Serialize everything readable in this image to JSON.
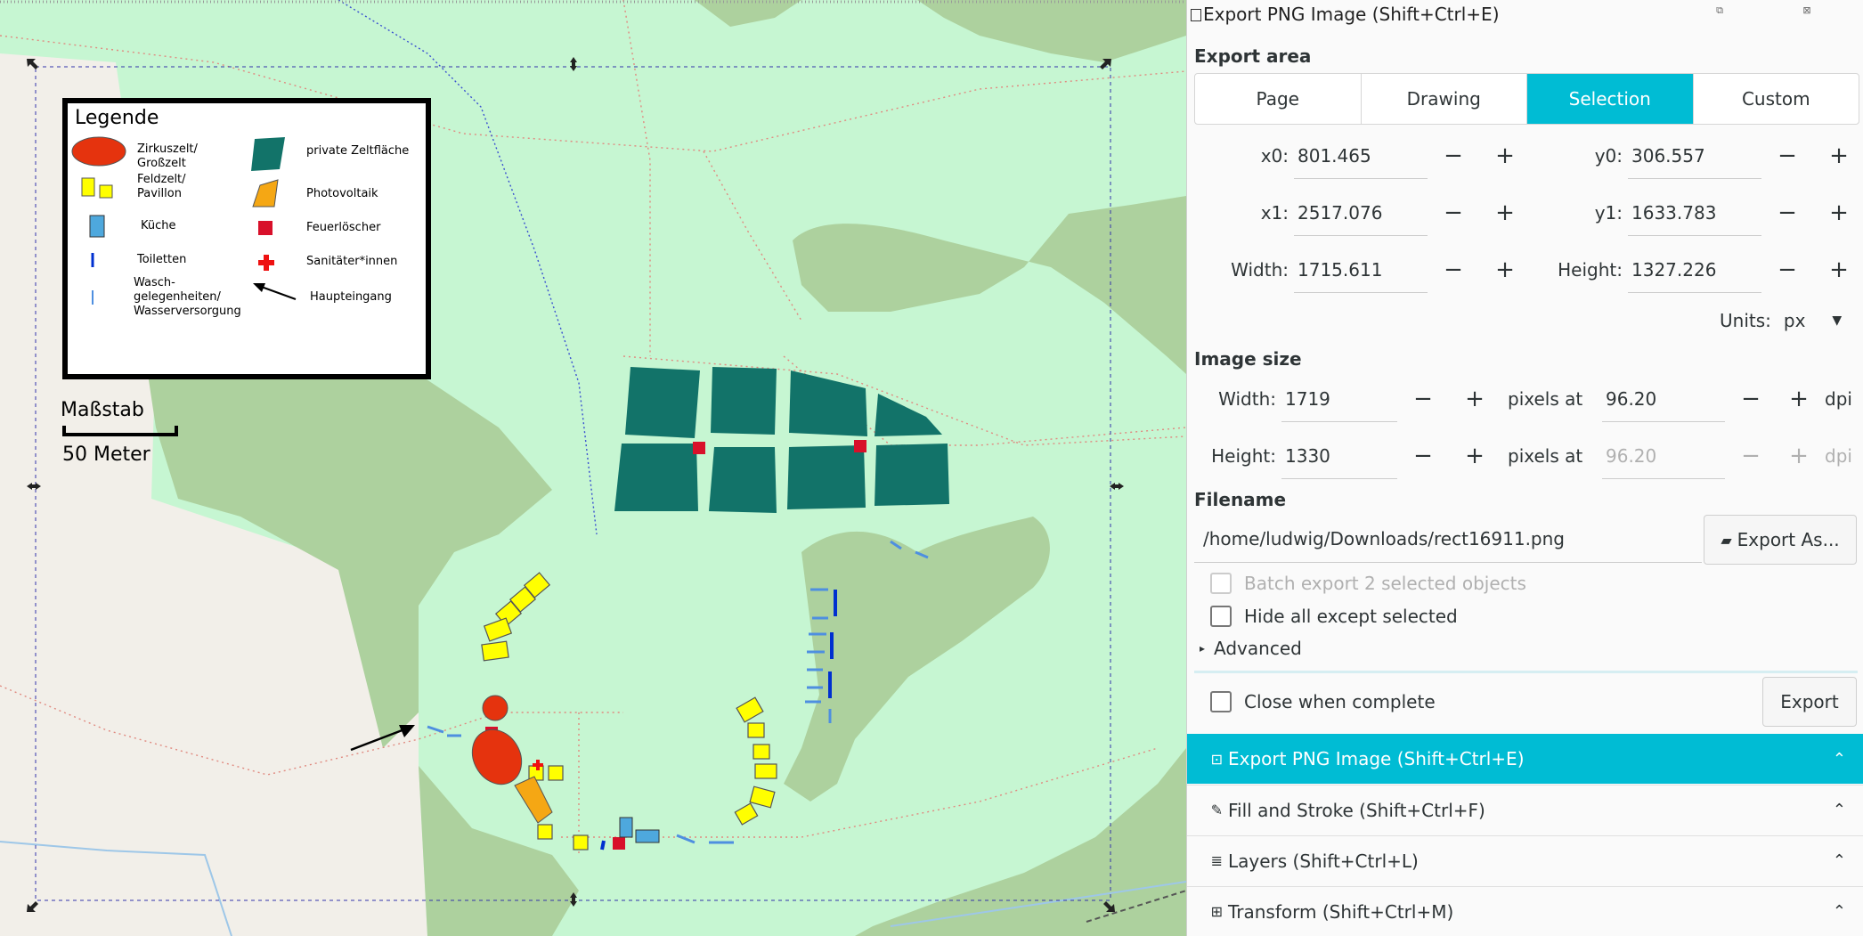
{
  "legend": {
    "title": "Legende",
    "items": [
      {
        "label": "Zirkuszelt/\nGroßzelt"
      },
      {
        "label": "Feldzelt/\nPavillon"
      },
      {
        "label": "Küche"
      },
      {
        "label": "Toiletten"
      },
      {
        "label": "Wasch-\ngelegenheiten/\nWasserversorgung"
      },
      {
        "label": "private Zeltfläche"
      },
      {
        "label": "Photovoltaik"
      },
      {
        "label": "Feuerlöscher"
      },
      {
        "label": "Sanitäter*innen"
      },
      {
        "label": "Haupteingang"
      }
    ]
  },
  "scale": {
    "title": "Maßstab",
    "label": "50 Meter"
  },
  "colors": {
    "accent": "#00bcd4",
    "map_bg": "#c6f6d2",
    "forest": "#add19e",
    "tent_area": "#127369",
    "circus": "#e5330e",
    "pavilion": "#ffff00",
    "kitchen": "#4ea8dd",
    "toilet": "#0030d0",
    "pv": "#f5a714",
    "field": "#f2efe9"
  },
  "dialog": {
    "title": "Export PNG Image (Shift+Ctrl+E)",
    "export_area_heading": "Export area",
    "area_tabs": [
      {
        "label": "Page",
        "active": false
      },
      {
        "label": "Drawing",
        "active": false
      },
      {
        "label": "Selection",
        "active": true
      },
      {
        "label": "Custom",
        "active": false
      }
    ],
    "x0_label": "x0:",
    "x0": "801.465",
    "y0_label": "y0:",
    "y0": "306.557",
    "x1_label": "x1:",
    "x1": "2517.076",
    "y1_label": "y1:",
    "y1": "1633.783",
    "width_label": "Width:",
    "width": "1715.611",
    "height_label": "Height:",
    "height": "1327.226",
    "units_label": "Units:",
    "units": "px",
    "image_size_heading": "Image size",
    "img_width_label": "Width:",
    "img_width": "1719",
    "img_height_label": "Height:",
    "img_height": "1330",
    "pixels_at": "pixels at",
    "dpi": "96.20",
    "dpi2": "96.20",
    "dpi_unit": "dpi",
    "filename_heading": "Filename",
    "filename": "/home/ludwig/Downloads/rect16911.png",
    "export_as": "Export As...",
    "batch_export": "Batch export 2 selected objects",
    "hide_except": "Hide all except selected",
    "advanced": "Advanced",
    "close_when_complete": "Close when complete",
    "export": "Export",
    "minus": "−",
    "plus": "+"
  },
  "docks": [
    {
      "label": "Export PNG Image (Shift+Ctrl+E)",
      "active": true
    },
    {
      "label": "Fill and Stroke (Shift+Ctrl+F)",
      "active": false
    },
    {
      "label": "Layers (Shift+Ctrl+L)",
      "active": false
    },
    {
      "label": "Transform (Shift+Ctrl+M)",
      "active": false
    }
  ]
}
